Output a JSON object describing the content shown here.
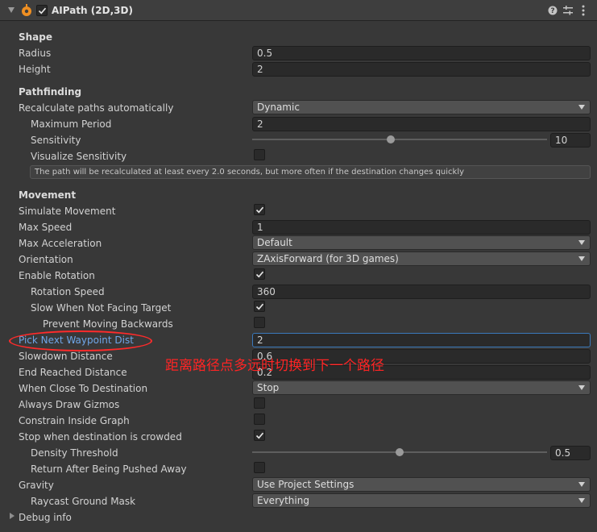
{
  "component": {
    "title": "AIPath (2D,3D)",
    "enabled": true,
    "header_icons": [
      "help-icon",
      "presets-icon",
      "more-options-icon"
    ]
  },
  "shape": {
    "heading": "Shape",
    "radius_label": "Radius",
    "radius_value": "0.5",
    "height_label": "Height",
    "height_value": "2"
  },
  "pathfinding": {
    "heading": "Pathfinding",
    "recalc_label": "Recalculate paths automatically",
    "recalc_value": "Dynamic",
    "max_period_label": "Maximum Period",
    "max_period_value": "2",
    "sensitivity_label": "Sensitivity",
    "sensitivity_value": "10",
    "sensitivity_fraction": 0.47,
    "visualize_label": "Visualize Sensitivity",
    "visualize_checked": false,
    "info": "The path will be recalculated at least every 2.0 seconds, but more often if the destination changes quickly"
  },
  "movement": {
    "heading": "Movement",
    "simulate_label": "Simulate Movement",
    "simulate_checked": true,
    "max_speed_label": "Max Speed",
    "max_speed_value": "1",
    "max_accel_label": "Max Acceleration",
    "max_accel_value": "Default",
    "orientation_label": "Orientation",
    "orientation_value": "ZAxisForward (for 3D games)",
    "enable_rotation_label": "Enable Rotation",
    "enable_rotation_checked": true,
    "rotation_speed_label": "Rotation Speed",
    "rotation_speed_value": "360",
    "slow_facing_label": "Slow When Not Facing Target",
    "slow_facing_checked": true,
    "prevent_back_label": "Prevent Moving Backwards",
    "prevent_back_checked": false,
    "pick_next_label": "Pick Next Waypoint Dist",
    "pick_next_value": "2",
    "slowdown_label": "Slowdown Distance",
    "slowdown_value": "0.6",
    "end_reached_label": "End Reached Distance",
    "end_reached_value": "0.2",
    "close_dest_label": "When Close To Destination",
    "close_dest_value": "Stop",
    "always_gizmos_label": "Always Draw Gizmos",
    "always_gizmos_checked": false,
    "constrain_label": "Constrain Inside Graph",
    "constrain_checked": false,
    "stop_crowded_label": "Stop when destination is crowded",
    "stop_crowded_checked": true,
    "density_label": "Density Threshold",
    "density_value": "0.5",
    "density_fraction": 0.5,
    "return_pushed_label": "Return After Being Pushed Away",
    "return_pushed_checked": false,
    "gravity_label": "Gravity",
    "gravity_value": "Use Project Settings",
    "raycast_label": "Raycast Ground Mask",
    "raycast_value": "Everything",
    "debug_label": "Debug info"
  },
  "annotation": {
    "text": "距离路径点多远时切换到下一个路径",
    "color": "#ff2424"
  },
  "colors": {
    "background": "#383838",
    "field": "#2a2a2a",
    "dropdown": "#515151",
    "focus": "#3a79bb",
    "highlight_label": "#6fa6e8"
  }
}
